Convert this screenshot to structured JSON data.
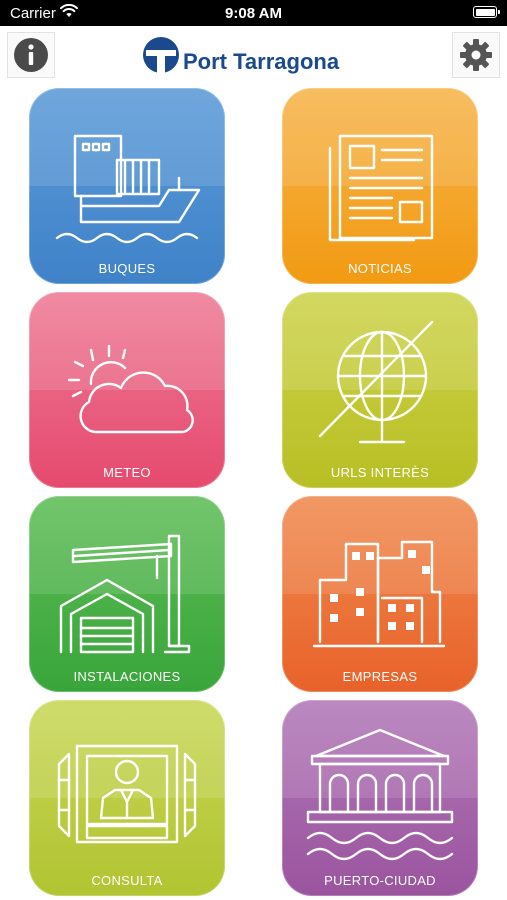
{
  "status_bar": {
    "carrier": "Carrier",
    "time": "9:08 AM"
  },
  "header": {
    "brand": "Port Tarragona"
  },
  "tiles": [
    {
      "label": "BUQUES"
    },
    {
      "label": "NOTICIAS"
    },
    {
      "label": "METEO"
    },
    {
      "label": "URLS INTERÈS"
    },
    {
      "label": "INSTALACIONES"
    },
    {
      "label": "EMPRESAS"
    },
    {
      "label": "CONSULTA"
    },
    {
      "label": "PUERTO-CIUDAD"
    }
  ],
  "icons": {
    "info": "info-icon",
    "settings": "gear-icon",
    "tiles": [
      "ship-icon",
      "newspaper-icon",
      "weather-icon",
      "globe-icon",
      "warehouse-icon",
      "buildings-icon",
      "consultation-icon",
      "port-city-icon"
    ]
  },
  "colors": {
    "brand": "#1a4a8c",
    "buques": "#3f82c8",
    "noticias": "#f29a12",
    "meteo": "#e54a6e",
    "urls": "#b8bf24",
    "instalaciones": "#38a53a",
    "empresas": "#e8622a",
    "consulta": "#b1c431",
    "puerto": "#9a549e"
  }
}
